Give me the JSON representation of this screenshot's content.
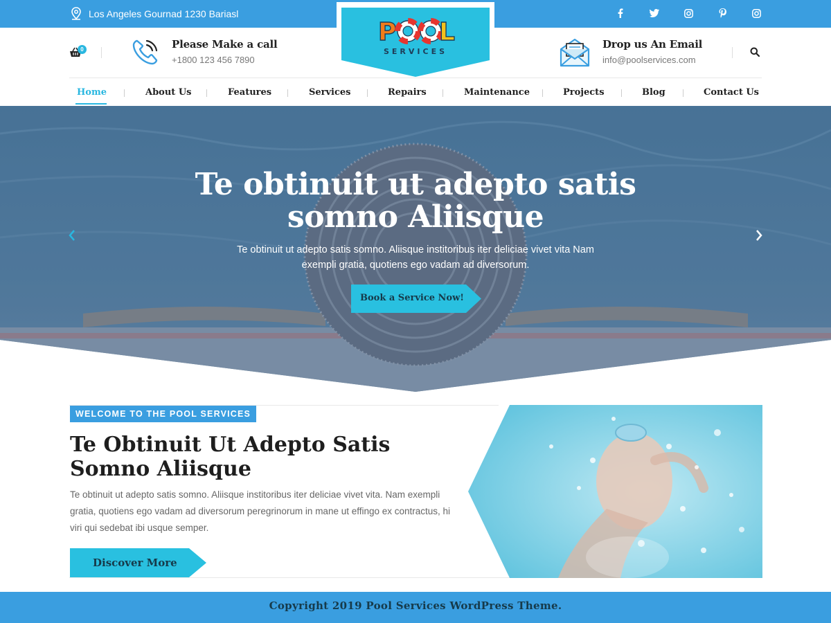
{
  "topbar": {
    "address": "Los Angeles Gournad 1230 Bariasl",
    "socials": [
      {
        "icon": "facebook-icon",
        "glyph": "f"
      },
      {
        "icon": "twitter-icon",
        "glyph": "t"
      },
      {
        "icon": "instagram-icon",
        "glyph": ""
      },
      {
        "icon": "pinterest-icon",
        "glyph": "p"
      },
      {
        "icon": "instagram-icon",
        "glyph": ""
      }
    ]
  },
  "logo": {
    "word": "POOL",
    "tagline": "SERVICES"
  },
  "header": {
    "cart_count": "0",
    "call_title": "Please Make a call",
    "call_number": "+1800 123 456 7890",
    "email_title": "Drop us An Email",
    "email_address": "info@poolservices.com"
  },
  "nav": {
    "items": [
      "Home",
      "About Us",
      "Features",
      "Services",
      "Repairs",
      "Maintenance",
      "Projects",
      "Blog",
      "Contact Us"
    ],
    "active": "Home"
  },
  "hero": {
    "title": "Te obtinuit ut adepto satis somno Aliisque",
    "text": "Te obtinuit ut adepto satis somno. Aliisque institoribus iter deliciae vivet vita Nam exempli gratia, quotiens ego vadam ad diversorum.",
    "cta": "Book a Service Now!"
  },
  "about": {
    "tag": "WELCOME TO THE POOL SERVICES",
    "title": "Te Obtinuit Ut Adepto Satis Somno Aliisque",
    "text": "Te obtinuit ut adepto satis somno. Aliisque institoribus iter deliciae vivet vita. Nam exempli gratia, quotiens ego vadam ad diversorum peregrinorum in mane ut effingo ex contractus, hi viri qui sedebat ibi usque semper.",
    "cta": "Discover More"
  },
  "footer": {
    "copyright": "Copyright 2019 Pool Services WordPress Theme."
  },
  "colors": {
    "primary": "#3a9ee0",
    "accent": "#29b7e0",
    "dark": "#163a4a"
  }
}
